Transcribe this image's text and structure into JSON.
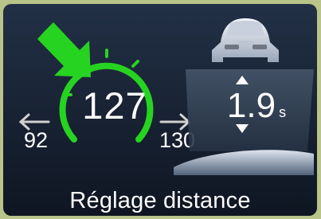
{
  "gauge": {
    "current_speed": "127",
    "min_speed": "92",
    "max_speed": "130"
  },
  "distance": {
    "value": "1.9",
    "unit": "s"
  },
  "footer": {
    "label": "Réglage distance"
  },
  "colors": {
    "accent": "#27d321",
    "panel_top": "#223046",
    "panel_bottom": "#0f1622",
    "text": "#ffffff"
  },
  "icons": {
    "arrow_setting": "green-arrow-icon",
    "left_arrow": "arrow-left-icon",
    "right_arrow": "arrow-right-icon",
    "car": "car-rear-icon",
    "up": "triangle-up-icon",
    "down": "triangle-down-icon"
  }
}
